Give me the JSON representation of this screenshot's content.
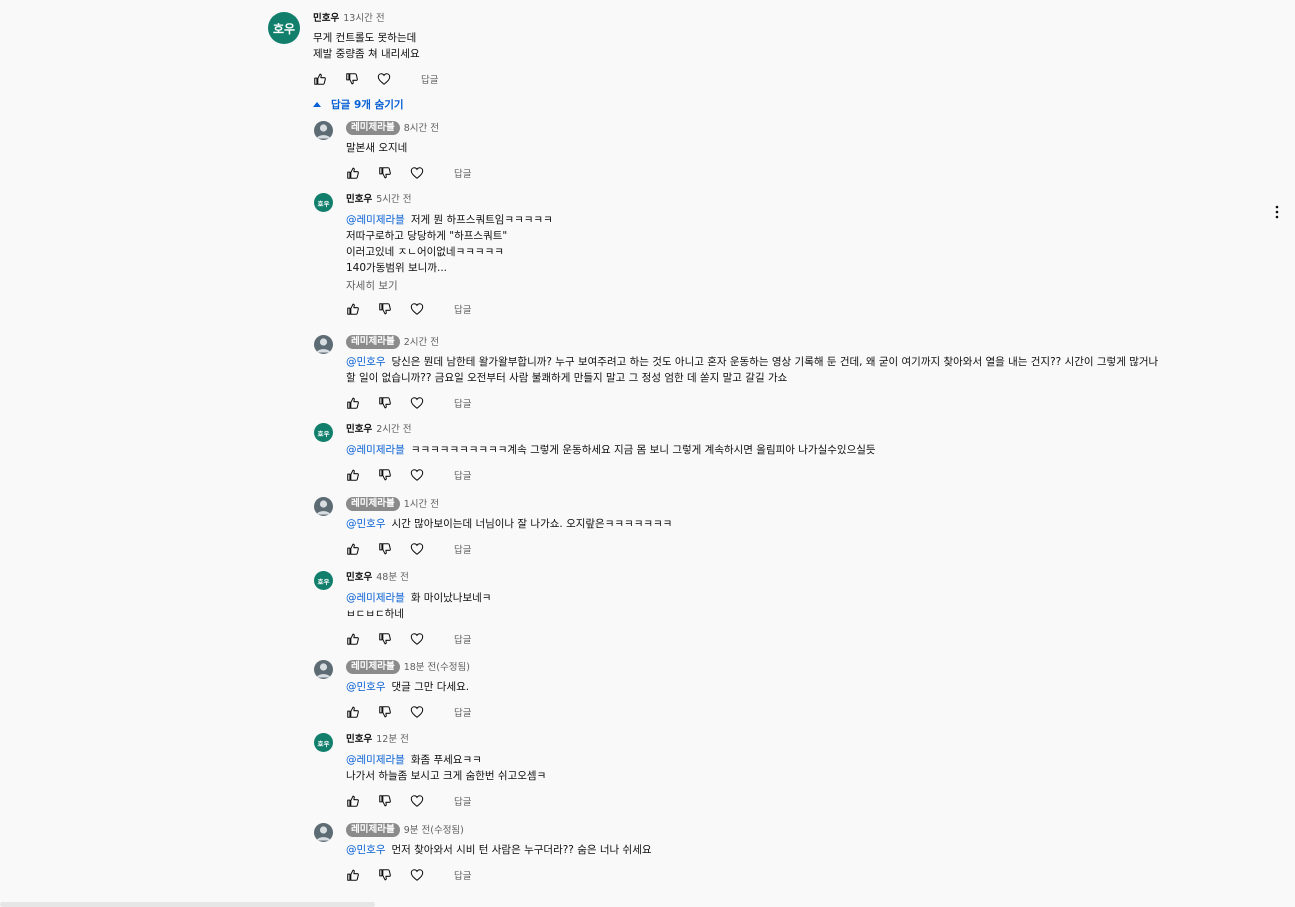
{
  "top_comment": {
    "avatar_text": "호우",
    "author": "민호우",
    "time": "13시간 전",
    "lines": [
      "무게 컨트롤도 못하는데",
      "제발 중량좀 쳐 내리세요"
    ],
    "reply_label": "답글"
  },
  "replies_toggle": {
    "label": "답글 9개 숨기기"
  },
  "replies": [
    {
      "author": "레미제라블",
      "time": "8시간 전",
      "mention": "",
      "lines": [
        "말본새 오지네"
      ],
      "reply_label": "답글"
    },
    {
      "avatar_text": "호우",
      "author": "민호우",
      "time": "5시간 전",
      "mention": "@레미제라블",
      "lines": [
        "저게 뭔 하프스쿼트임ㅋㅋㅋㅋㅋ",
        "저따구로하고 당당하게 \"하프스쿼트\"",
        "이러고있네 ㅈㄴ어이없네ㅋㅋㅋㅋㅋ",
        "140가동범위 보니까..."
      ],
      "more": "자세히 보기",
      "reply_label": "답글"
    },
    {
      "author": "레미제라블",
      "time": "2시간 전",
      "mention": "@민호우",
      "lines": [
        "당신은 뭔데 남한테 왈가왈부합니까? 누구 보여주려고 하는 것도 아니고 혼자 운동하는 영상 기록해 둔 건데, 왜 굳이 여기까지 찾아와서 열을 내는 건지?? 시간이 그렇게 많거나",
        "할 일이 없습니까?? 금요일 오전부터 사람 불쾌하게 만들지 말고 그 정성 엄한 데 쏟지 말고 갈길 가쇼"
      ],
      "reply_label": "답글"
    },
    {
      "avatar_text": "호우",
      "author": "민호우",
      "time": "2시간 전",
      "mention": "@레미제라블",
      "lines": [
        "ㅋㅋㅋㅋㅋㅋㅋㅋㅋㅋ계속 그렇게 운동하세요 지금 몸 보니 그렇게 계속하시면 올림피아 나가실수있으실듯"
      ],
      "reply_label": "답글"
    },
    {
      "author": "레미제라블",
      "time": "1시간 전",
      "mention": "@민호우",
      "lines": [
        "시간 많아보이는데 너님이나 잘 나가쇼. 오지랖은ㅋㅋㅋㅋㅋㅋㅋ"
      ],
      "reply_label": "답글"
    },
    {
      "avatar_text": "호우",
      "author": "민호우",
      "time": "48분 전",
      "mention": "@레미제라블",
      "lines": [
        "화 마이났나보네ㅋ",
        "ㅂㄷㅂㄷ하네"
      ],
      "reply_label": "답글"
    },
    {
      "author": "레미제라블",
      "time": "18분 전(수정됨)",
      "mention": "@민호우",
      "lines": [
        "댓글 그만 다세요."
      ],
      "reply_label": "답글"
    },
    {
      "avatar_text": "호우",
      "author": "민호우",
      "time": "12분 전",
      "mention": "@레미제라블",
      "lines": [
        "화좀 푸세요ㅋㅋ",
        "나가서 하늘좀 보시고 크게 숨한번 쉬고오셈ㅋ"
      ],
      "reply_label": "답글"
    },
    {
      "author": "레미제라블",
      "time": "9분 전(수정됨)",
      "mention": "@민호우",
      "lines": [
        "먼저 찾아와서 시비 턴 사람은 누구더라?? 숨은 너나 쉬세요"
      ],
      "reply_label": "답글"
    }
  ],
  "icons": {
    "like": "thumb-up-icon",
    "dislike": "thumb-down-icon",
    "heart": "heart-icon",
    "menu": "more-vert-icon",
    "caret": "caret-up-icon"
  },
  "colors": {
    "link": "#065fd4",
    "avatar_green": "#117f6c",
    "chip_gray": "#8b8b8b",
    "muted": "#606060"
  }
}
